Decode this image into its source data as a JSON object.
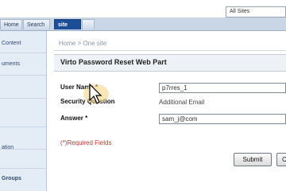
{
  "site_selector": {
    "value": "All Sites"
  },
  "tabs": [
    {
      "label": "Home",
      "active": false
    },
    {
      "label": "Search",
      "active": false
    },
    {
      "label": "site",
      "active": true
    },
    {
      "label": "",
      "active": false
    }
  ],
  "left_nav": {
    "items": [
      {
        "label": "Content"
      },
      {
        "label": "uments"
      },
      {
        "label": ""
      },
      {
        "label": ""
      },
      {
        "label": ""
      },
      {
        "label": "ation"
      },
      {
        "label": ""
      },
      {
        "label": "Groups"
      }
    ]
  },
  "breadcrumb": {
    "text": "Home > One site"
  },
  "form": {
    "title": "Virto Password Reset Web Part",
    "fields": [
      {
        "label": "User Name *",
        "value": "p7rres_1"
      },
      {
        "label": "Security Question",
        "value": "Additional Email"
      },
      {
        "label": "Answer *",
        "value": "sam_j@com"
      }
    ],
    "required_note": "(*)Required Fields",
    "submit_label": "Submit",
    "cancel_label": "C"
  },
  "colors": {
    "tab_active": "#1b4e97",
    "nav_background": "#e4ecf6",
    "required_text": "#c0392b"
  }
}
